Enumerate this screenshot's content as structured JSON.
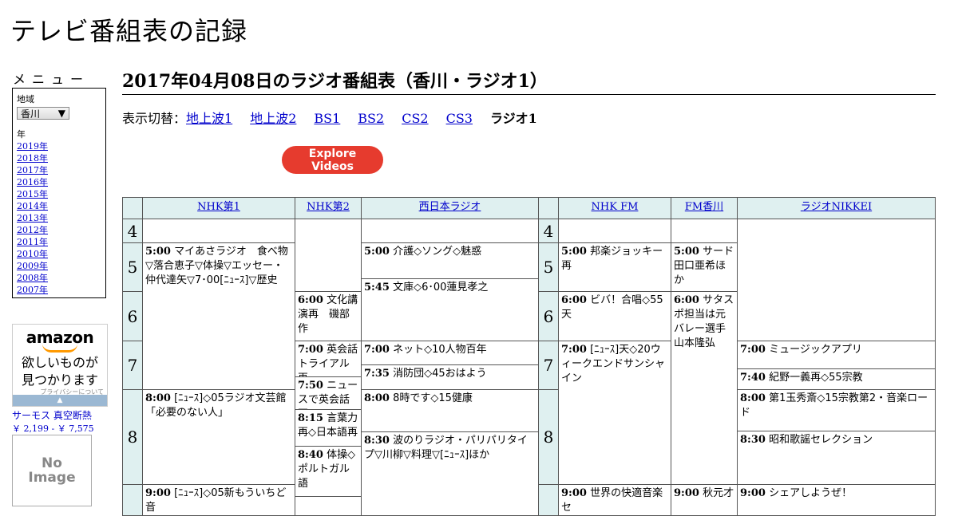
{
  "site_title": "テレビ番組表の記録",
  "menu": {
    "title": "メニュー",
    "region_label": "地域",
    "region_value": "香川",
    "year_label": "年",
    "years": [
      "2019年",
      "2018年",
      "2017年",
      "2016年",
      "2015年",
      "2014年",
      "2013年",
      "2012年",
      "2011年",
      "2010年",
      "2009年",
      "2008年",
      "2007年"
    ]
  },
  "ad": {
    "logo": "amazon",
    "tagline_1": "欲しいものが",
    "tagline_2": "見つかります",
    "privacy": "プライバシーについて"
  },
  "product": {
    "name": "サーモス 真空断熱",
    "price": "￥ 2,199 - ￥ 7,575",
    "noimage_1": "No",
    "noimage_2": "Image"
  },
  "page_title": "2017年04月08日のラジオ番組表（香川・ラジオ1）",
  "switcher": {
    "label": "表示切替：",
    "links": [
      "地上波1",
      "地上波2",
      "BS1",
      "BS2",
      "CS2",
      "CS3"
    ],
    "current": "ラジオ1"
  },
  "explore_button": "Explore Videos",
  "channels": [
    "NHK第1",
    "NHK第2",
    "西日本ラジオ",
    "NHK FM",
    "FM香川",
    "ラジオNIKKEI"
  ],
  "hours": [
    "4",
    "5",
    "6",
    "7",
    "8"
  ],
  "programs": {
    "nhk1_500": {
      "time": "5:00",
      "title": "マイあさラジオ　食べ物▽落合恵子▽体操▽エッセー・仲代達矢▽7･00[ﾆｭｰｽ]▽歴史"
    },
    "nhk1_800": {
      "time": "8:00",
      "title": "[ﾆｭｰｽ]◇05ラジオ文芸館「必要のない人」"
    },
    "nhk1_900": {
      "time": "9:00",
      "title": "[ﾆｭｰｽ]◇05新もういちど音"
    },
    "nhk2_600": {
      "time": "6:00",
      "title": "文化講演再　磯部作"
    },
    "nhk2_700": {
      "time": "7:00",
      "title": "英会話トライアル再"
    },
    "nhk2_750": {
      "time": "7:50",
      "title": "ニュースで英会話再"
    },
    "nhk2_815": {
      "time": "8:15",
      "title": "言葉力再◇日本語再"
    },
    "nhk2_840": {
      "time": "8:40",
      "title": "体操◇ポルトガル語"
    },
    "nrb_500": {
      "time": "5:00",
      "title": "介護◇ソング◇魅惑"
    },
    "nrb_545": {
      "time": "5:45",
      "title": "文庫◇6･00蓮見孝之"
    },
    "nrb_700": {
      "time": "7:00",
      "title": "ネット◇10人物百年"
    },
    "nrb_735": {
      "time": "7:35",
      "title": "消防団◇45おはよう"
    },
    "nrb_800": {
      "time": "8:00",
      "title": "8時です◇15健康"
    },
    "nrb_830": {
      "time": "8:30",
      "title": "波のりラジオ・パリパリタイプ▽川柳▽料理▽[ﾆｭｰｽ]ほか"
    },
    "fm_500": {
      "time": "5:00",
      "title": "邦楽ジョッキー再"
    },
    "fm_600": {
      "time": "6:00",
      "title": "ビバ！合唱◇55天"
    },
    "fm_700": {
      "time": "7:00",
      "title": "[ﾆｭｰｽ]天◇20ウィークエンドサンシャイン"
    },
    "fm_900": {
      "time": "9:00",
      "title": "世界の快適音楽セ"
    },
    "fmk_500": {
      "time": "5:00",
      "title": "サード田口亜希ほか"
    },
    "fmk_600": {
      "time": "6:00",
      "title": "サタスポ担当は元バレー選手山本隆弘"
    },
    "fmk_900": {
      "time": "9:00",
      "title": "秋元才"
    },
    "nikkei_700": {
      "time": "7:00",
      "title": "ミュージックアプリ"
    },
    "nikkei_740": {
      "time": "7:40",
      "title": "紀野一義再◇55宗教"
    },
    "nikkei_800": {
      "time": "8:00",
      "title": "第1玉秀斎◇15宗教第2・音楽ロード"
    },
    "nikkei_830": {
      "time": "8:30",
      "title": "昭和歌謡セレクション"
    },
    "nikkei_900": {
      "time": "9:00",
      "title": "シェアしようぜ！"
    }
  }
}
